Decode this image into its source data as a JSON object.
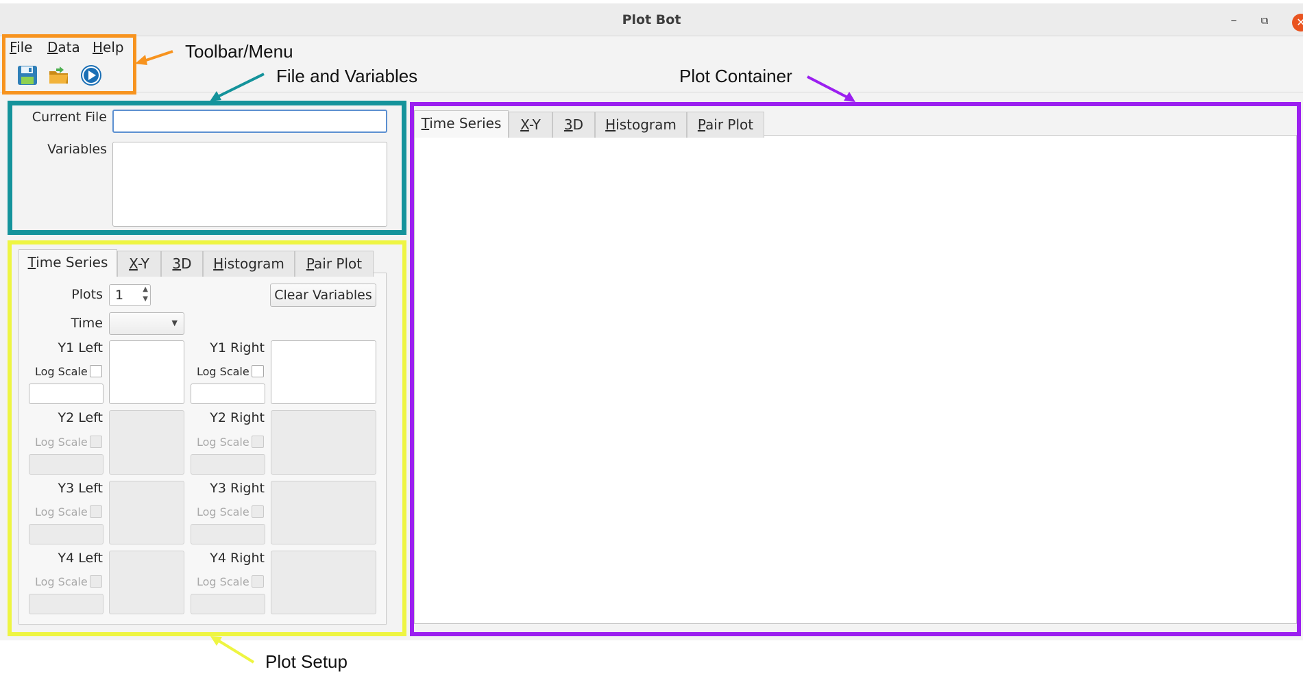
{
  "window": {
    "title": "Plot Bot",
    "minimize_glyph": "–",
    "restore_glyph": "⧉",
    "close_glyph": "✕"
  },
  "menu": {
    "file": {
      "mnemonic": "F",
      "rest": "ile"
    },
    "data": {
      "mnemonic": "D",
      "rest": "ata"
    },
    "help": {
      "mnemonic": "H",
      "rest": "elp"
    }
  },
  "toolbar": {
    "icons": [
      "save-icon",
      "open-folder-icon",
      "run-play-icon"
    ]
  },
  "file_panel": {
    "current_file_label": "Current File",
    "current_file_value": "",
    "variables_label": "Variables"
  },
  "setup_tabs": [
    {
      "mnemonic": "T",
      "rest": "ime Series",
      "active": true
    },
    {
      "mnemonic": "X",
      "rest": "-Y",
      "active": false
    },
    {
      "mnemonic": "3",
      "rest": "D",
      "active": false
    },
    {
      "mnemonic": "H",
      "rest": "istogram",
      "active": false
    },
    {
      "mnemonic": "P",
      "rest": "air Plot",
      "active": false
    }
  ],
  "setup": {
    "plots_label": "Plots",
    "plots_value": "1",
    "clear_button": "Clear Variables",
    "time_label": "Time",
    "log_scale_label": "Log Scale",
    "axes": [
      {
        "left": "Y1 Left",
        "right": "Y1 Right",
        "enabled": true
      },
      {
        "left": "Y2 Left",
        "right": "Y2 Right",
        "enabled": false
      },
      {
        "left": "Y3 Left",
        "right": "Y3 Right",
        "enabled": false
      },
      {
        "left": "Y4 Left",
        "right": "Y4 Right",
        "enabled": false
      }
    ]
  },
  "plot_tabs": [
    {
      "mnemonic": "T",
      "rest": "ime Series",
      "active": true
    },
    {
      "mnemonic": "X",
      "rest": "-Y",
      "active": false
    },
    {
      "mnemonic": "3",
      "rest": "D",
      "active": false
    },
    {
      "mnemonic": "H",
      "rest": "istogram",
      "active": false
    },
    {
      "mnemonic": "P",
      "rest": "air Plot",
      "active": false
    }
  ],
  "annotations": {
    "toolbar_menu": "Toolbar/Menu",
    "file_variables": "File and Variables",
    "plot_container": "Plot Container",
    "plot_setup": "Plot Setup",
    "colors": {
      "toolbar_menu": "#f7931e",
      "file_variables": "#14939b",
      "plot_container": "#9b1ff0",
      "plot_setup": "#eef542"
    }
  }
}
